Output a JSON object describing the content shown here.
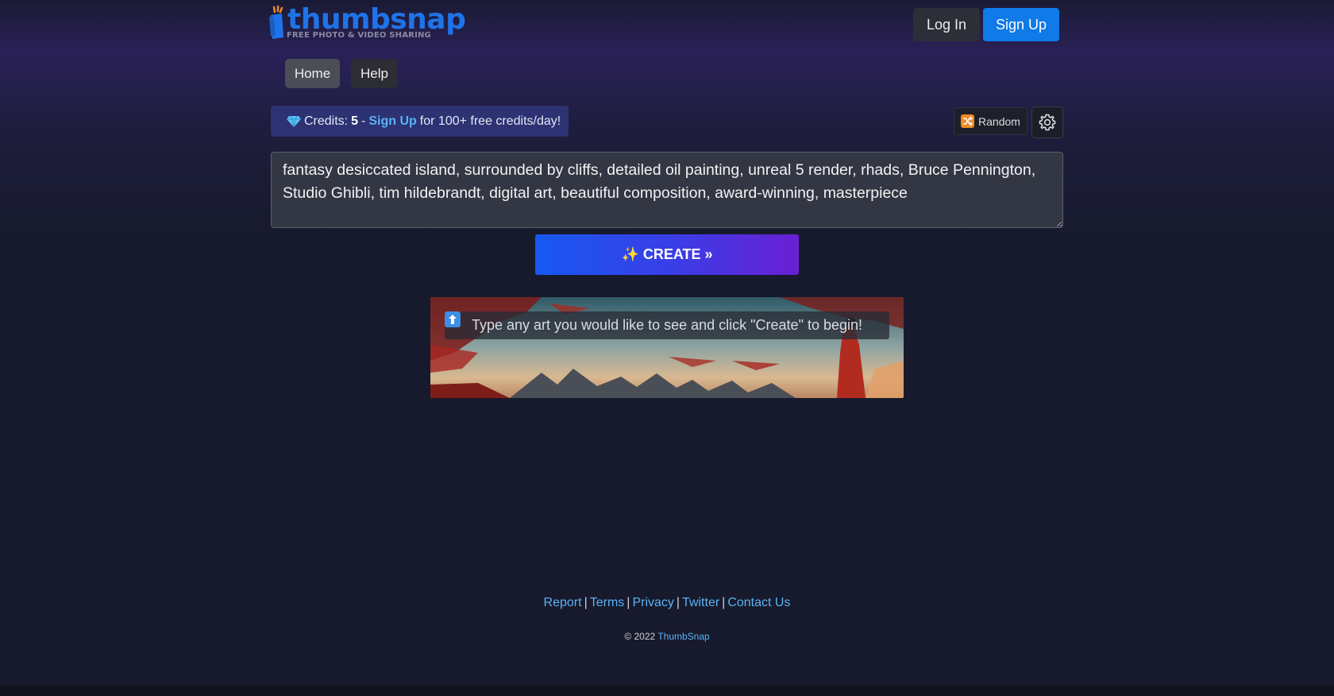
{
  "header": {
    "logo_text": "thumbsnap",
    "logo_tagline": "FREE PHOTO & VIDEO SHARING",
    "login_label": "Log In",
    "signup_label": "Sign Up"
  },
  "nav": {
    "items": [
      {
        "label": "Home",
        "active": true
      },
      {
        "label": "Help",
        "active": false
      }
    ]
  },
  "credits": {
    "icon": "gem-icon",
    "prefix": "Credits:",
    "count": "5",
    "dash": "-",
    "signup_link": "Sign Up",
    "suffix": "for 100+ free credits/day!"
  },
  "toolbar": {
    "random_icon": "shuffle-icon",
    "random_label": "Random",
    "settings_icon": "gear-icon"
  },
  "prompt": {
    "value": "fantasy desiccated island, surrounded by cliffs, detailed oil painting, unreal 5 render, rhads, Bruce Pennington, Studio Ghibli, tim hildebrandt, digital art, beautiful composition, award-winning, masterpiece"
  },
  "create_button": {
    "label": "✨ CREATE »"
  },
  "banner": {
    "icon": "up-arrow-icon",
    "message": "Type any art you would like to see and click \"Create\" to begin!"
  },
  "footer": {
    "links": [
      "Report",
      "Terms",
      "Privacy",
      "Twitter",
      "Contact Us"
    ],
    "separator": "|",
    "copyright_prefix": "© 2022",
    "copyright_link": "ThumbSnap"
  },
  "colors": {
    "accent_blue": "#0f7ae8",
    "link_blue": "#5ab2f5",
    "credits_bg": "#2d3273",
    "create_gradient_start": "#1759f2",
    "create_gradient_end": "#6a1fd3"
  }
}
